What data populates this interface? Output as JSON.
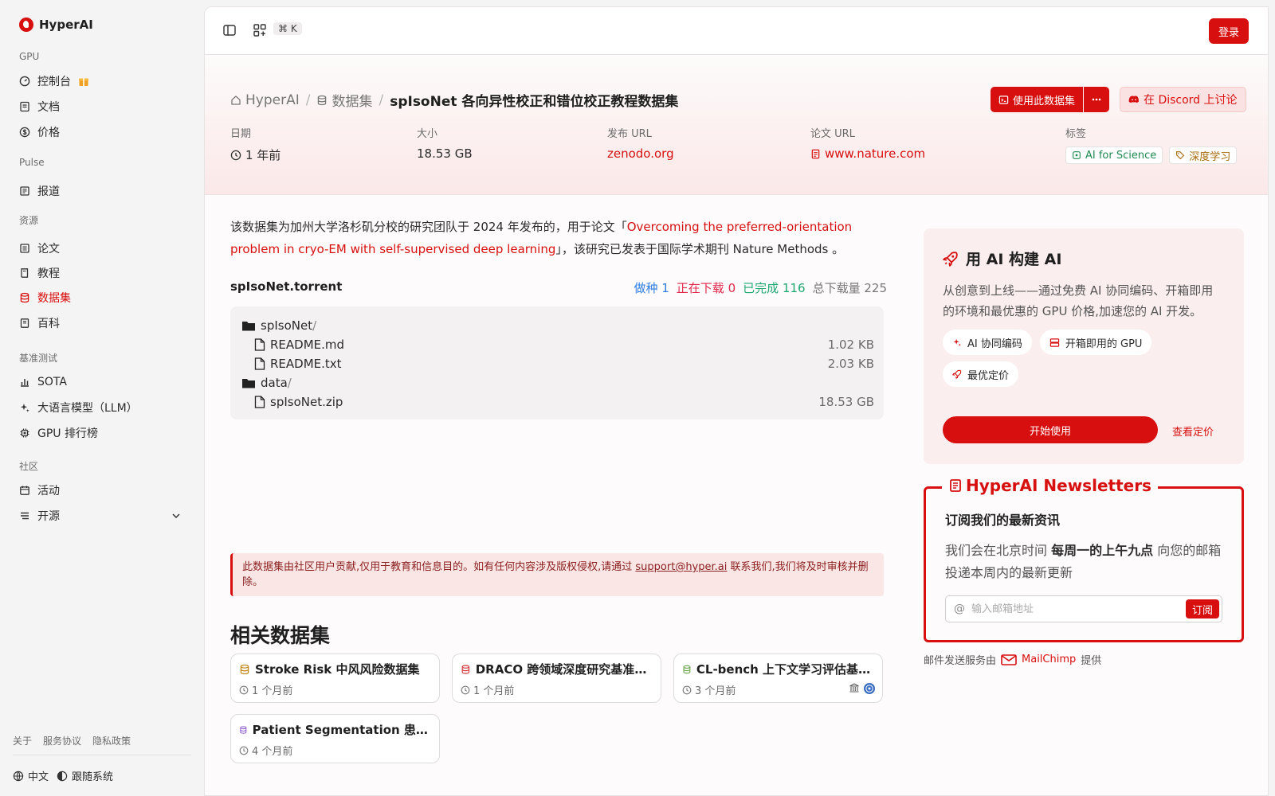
{
  "brand": {
    "name": "HyperAI"
  },
  "sidebar": {
    "sections": [
      {
        "label": "GPU",
        "items": [
          {
            "label": "控制台"
          },
          {
            "label": "文档"
          },
          {
            "label": "价格"
          }
        ]
      },
      {
        "label": "Pulse",
        "items": [
          {
            "label": "报道"
          }
        ]
      },
      {
        "label": "资源",
        "items": [
          {
            "label": "论文"
          },
          {
            "label": "教程"
          },
          {
            "label": "数据集"
          },
          {
            "label": "百科"
          }
        ]
      },
      {
        "label": "基准测试",
        "items": [
          {
            "label": "SOTA"
          },
          {
            "label": "大语言模型（LLM）"
          },
          {
            "label": "GPU 排行榜"
          }
        ]
      },
      {
        "label": "社区",
        "items": [
          {
            "label": "活动"
          },
          {
            "label": "开源"
          }
        ]
      }
    ],
    "footer_links": [
      "关于",
      "服务协议",
      "隐私政策"
    ],
    "language": "中文",
    "theme": "跟随系统"
  },
  "topbar": {
    "shortcut": "⌘ K",
    "login": "登录"
  },
  "breadcrumb": {
    "home": "HyperAI",
    "section": "数据集",
    "current": "spIsoNet 各向异性校正和错位校正教程数据集"
  },
  "actions": {
    "use_dataset": "使用此数据集",
    "discord": "在 Discord 上讨论"
  },
  "meta": {
    "date_label": "日期",
    "date_value": "1 年前",
    "size_label": "大小",
    "size_value": "18.53 GB",
    "publish_label": "发布 URL",
    "publish_value": "zenodo.org",
    "paper_label": "论文 URL",
    "paper_value": "www.nature.com",
    "tags_label": "标签",
    "tags": [
      "AI for Science",
      "深度学习"
    ]
  },
  "description": {
    "prefix": "该数据集为加州大学洛杉矶分校的研究团队于 2024 年发布的，用于论文「",
    "link": "Overcoming the preferred-orientation problem in cryo-EM with self-supervised deep learning",
    "suffix": "」，该研究已发表于国际学术期刊 Nature Methods 。"
  },
  "torrent": {
    "name": "spIsoNet.torrent",
    "seeding_label": "做种",
    "seeding": "1",
    "downloading_label": "正在下载",
    "downloading": "0",
    "completed_label": "已完成",
    "completed": "116",
    "total_label": "总下载量",
    "total": "225",
    "files": [
      {
        "name": "spIsoNet",
        "suffix": "/",
        "type": "folder",
        "size": ""
      },
      {
        "name": "README.md",
        "suffix": "",
        "type": "file",
        "size": "1.02 KB"
      },
      {
        "name": "README.txt",
        "suffix": "",
        "type": "file",
        "size": "2.03 KB"
      },
      {
        "name": "data",
        "suffix": "/",
        "type": "folder",
        "size": ""
      },
      {
        "name": "spIsoNet.zip",
        "suffix": "",
        "type": "file",
        "size": "18.53 GB"
      }
    ]
  },
  "notice": {
    "text_before": "此数据集由社区用户贡献,仅用于教育和信息目的。如有任何内容涉及版权侵权,请通过 ",
    "email": "support@hyper.ai",
    "text_after": " 联系我们,我们将及时审核并删除。"
  },
  "related": {
    "title": "相关数据集",
    "items": [
      {
        "title": "Stroke Risk 中风风险数据集",
        "date": "1 个月前",
        "color": "#c58a1a"
      },
      {
        "title": "DRACO 跨领域深度研究基准数据集",
        "date": "1 个月前",
        "color": "#d33b3b"
      },
      {
        "title": "CL-bench 上下文学习评估基准数据集",
        "date": "3 个月前",
        "color": "#6aa84f"
      },
      {
        "title": "Patient Segmentation 患者分群数据集",
        "date": "4 个月前",
        "color": "#8e5bd1"
      }
    ]
  },
  "promo": {
    "title": "用 AI 构建 AI",
    "text": "从创意到上线——通过免费 AI 协同编码、开箱即用的环境和最优惠的 GPU 价格,加速您的 AI 开发。",
    "chips": [
      "AI 协同编码",
      "开箱即用的 GPU",
      "最优定价"
    ],
    "start": "开始使用",
    "pricing": "查看定价"
  },
  "newsletter": {
    "legend": "HyperAI Newsletters",
    "title": "订阅我们的最新资讯",
    "text_before": "我们会在北京时间 ",
    "text_bold": "每周一的上午九点",
    "text_after": " 向您的邮箱投递本周内的最新更新",
    "placeholder": "输入邮箱地址",
    "subscribe": "订阅",
    "provider_before": "邮件发送服务由",
    "provider": "MailChimp",
    "provider_after": "提供"
  },
  "colors": {
    "accent": "#d70f0f",
    "seeding": "#2f7ee0",
    "downloading": "#e0284b",
    "completed": "#1fa971"
  }
}
